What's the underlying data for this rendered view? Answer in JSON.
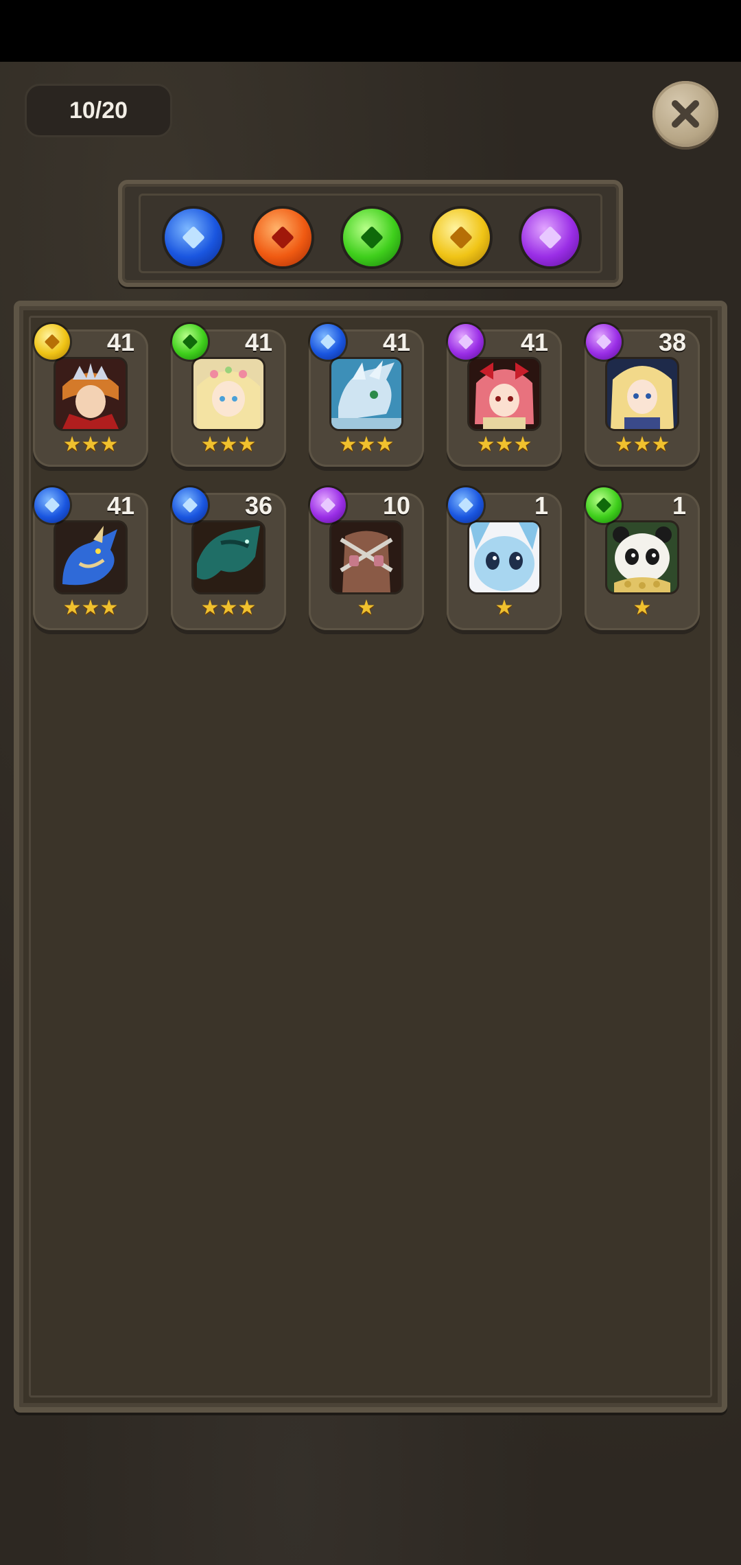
{
  "counter": {
    "text": "10/20"
  },
  "filter": {
    "orbs": [
      {
        "element": "water",
        "color": "#1a56e0"
      },
      {
        "element": "fire",
        "color": "#f05a12"
      },
      {
        "element": "wood",
        "color": "#3fcf1c"
      },
      {
        "element": "light",
        "color": "#f0c416"
      },
      {
        "element": "dark",
        "color": "#9a2ee6"
      }
    ]
  },
  "monsters": [
    {
      "element": "yellow",
      "level": "41",
      "stars": "★★★",
      "portrait": "crowned-hero"
    },
    {
      "element": "green",
      "level": "41",
      "stars": "★★★",
      "portrait": "blonde-girl"
    },
    {
      "element": "blue",
      "level": "41",
      "stars": "★★★",
      "portrait": "ice-dragon"
    },
    {
      "element": "purple",
      "level": "41",
      "stars": "★★★",
      "portrait": "red-hair-girl"
    },
    {
      "element": "purple",
      "level": "38",
      "stars": "★★★",
      "portrait": "blonde-mage"
    },
    {
      "element": "blue",
      "level": "41",
      "stars": "★★★",
      "portrait": "blue-dragon"
    },
    {
      "element": "blue",
      "level": "36",
      "stars": "★★★",
      "portrait": "teal-beast"
    },
    {
      "element": "purple",
      "level": "10",
      "stars": "★",
      "portrait": "wrapped-creature"
    },
    {
      "element": "blue",
      "level": "1",
      "stars": "★",
      "portrait": "blue-pup"
    },
    {
      "element": "green",
      "level": "1",
      "stars": "★",
      "portrait": "panda"
    }
  ]
}
